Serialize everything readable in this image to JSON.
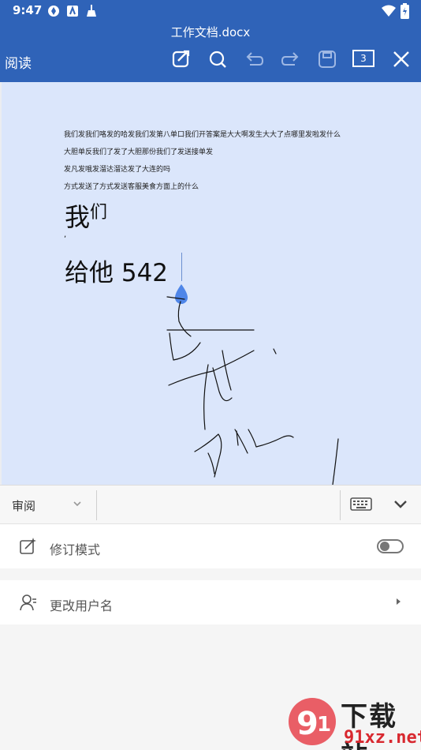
{
  "status_bar": {
    "time": "9:47"
  },
  "toolbar": {
    "doc_title": "工作文档.docx",
    "read_label": "阅读",
    "page_count": "3"
  },
  "document": {
    "lines": [
      "我们发我们咯发的哈发我们发第八单口我们开答案是大大啊发生大大了点哪里发啦发什么",
      "大胆单反我们了发了大胆那份我们了发送接单发",
      "发凡发哦发溜达溜达发了大连的吗",
      "方式发送了方式发送客服美食方面上的什么"
    ],
    "big_text_1_main": "我",
    "big_text_1_sup": "们",
    "comma": ",",
    "big_text_2": "给他 542"
  },
  "review_bar": {
    "mode_label": "审阅"
  },
  "settings": {
    "revision_mode_label": "修订模式",
    "revision_mode_on": false,
    "change_username_label": "更改用户名"
  },
  "watermark": {
    "name": "下载站",
    "url": "91xz.net"
  },
  "colors": {
    "accent": "#2f63b8",
    "page_bg": "#dbe6fb",
    "watermark_red": "#d8282f"
  }
}
